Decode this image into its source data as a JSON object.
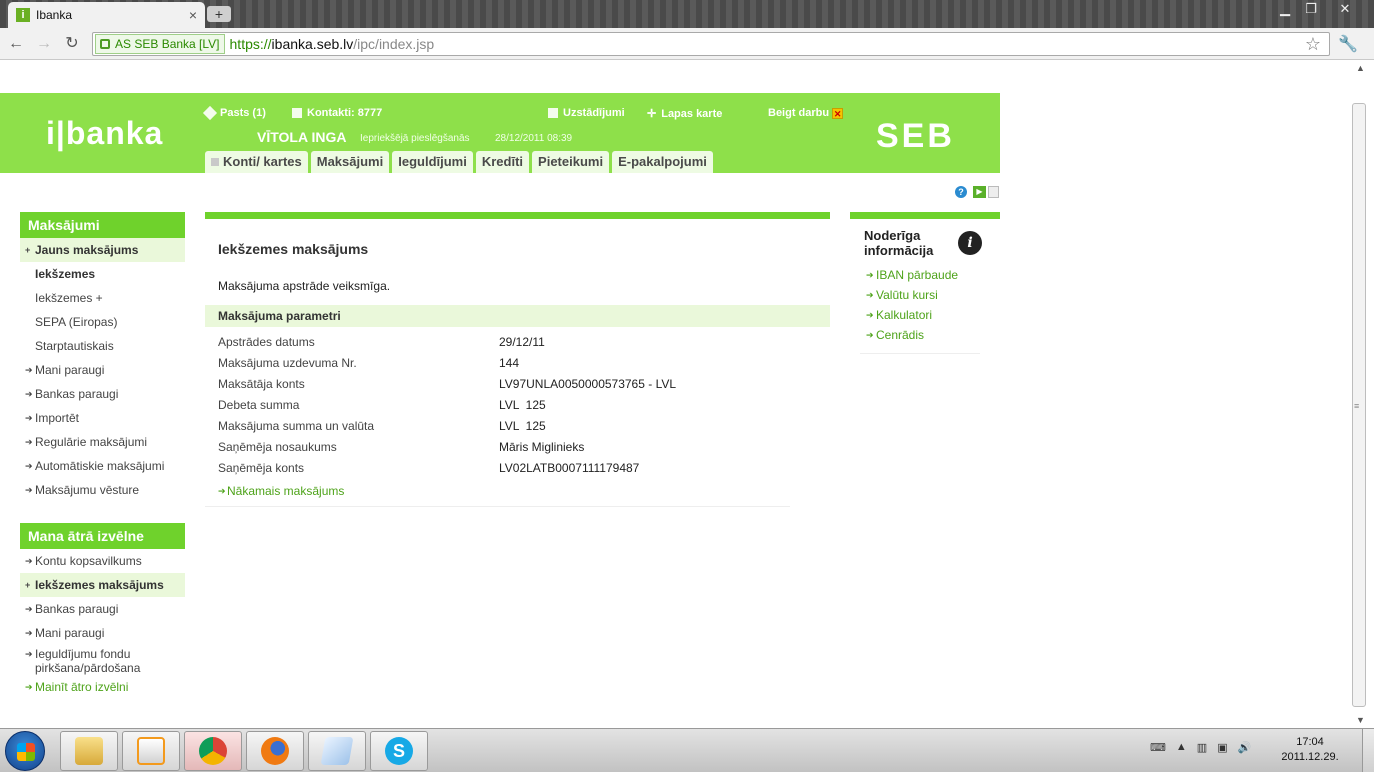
{
  "browser": {
    "tab_title": "Ibanka",
    "tab_favicon": "i",
    "tab_close": "×",
    "newtab": "+",
    "ev_label": "AS SEB Banka [LV]",
    "url_scheme": "https://",
    "url_host": "ibanka.seb.lv",
    "url_path": "/ipc/index.jsp"
  },
  "header": {
    "logo": "i|banka",
    "brand": "SEB",
    "mail": "Pasts (1)",
    "contacts": "Kontakti: 8777",
    "settings": "Uzstādījumi",
    "sitemap": "Lapas karte",
    "logout": "Beigt darbu",
    "user_name": "VĪTOLA INGA",
    "last_login_label": "Iepriekšējā pieslēgšanās",
    "last_login_date": "28/12/2011   08:39",
    "tabs": [
      "Konti/ kartes",
      "Maksājumi",
      "Ieguldījumi",
      "Kredīti",
      "Pieteikumi",
      "E-pakalpojumi"
    ]
  },
  "sidebar": {
    "title": "Maksājumi",
    "items": [
      "Jauns maksājums",
      "Iekšzemes",
      "Iekšzemes +",
      "SEPA (Eiropas)",
      "Starptautiskais",
      "Mani paraugi",
      "Bankas paraugi",
      "Importēt",
      "Regulārie maksājumi",
      "Automātiskie maksājumi",
      "Maksājumu vēsture"
    ]
  },
  "quickmenu": {
    "title": "Mana ātrā izvēlne",
    "items": [
      "Kontu kopsavilkums",
      "Iekšzemes maksājums",
      "Bankas paraugi",
      "Mani paraugi",
      "Ieguldījumu fondu pirkšana/pārdošana"
    ],
    "change_link": "Mainīt ātro izvēlni"
  },
  "main": {
    "title": "Iekšzemes maksājums",
    "message": "Maksājuma apstrāde veiksmīga.",
    "params_title": "Maksājuma parametri",
    "params": [
      {
        "label": "Apstrādes datums",
        "value": "29/12/11"
      },
      {
        "label": "Maksājuma uzdevuma Nr.",
        "value": "144"
      },
      {
        "label": "Maksātāja konts",
        "value": "LV97UNLA0050000573765 - LVL"
      },
      {
        "label": "Debeta summa",
        "value": "LVL  125"
      },
      {
        "label": "Maksājuma summa un valūta",
        "value": "LVL  125"
      },
      {
        "label": "Saņēmēja nosaukums",
        "value": "Māris Miglinieks"
      },
      {
        "label": "Saņēmēja konts",
        "value": "LV02LATB0007111179487"
      }
    ],
    "next_link": "Nākamais maksājums"
  },
  "info": {
    "title": "Noderīga informācija",
    "items": [
      "IBAN pārbaude",
      "Valūtu kursi",
      "Kalkulatori",
      "Cenrādis"
    ]
  },
  "taskbar": {
    "clock_time": "17:04",
    "clock_date": "2011.12.29."
  },
  "colors": {
    "brand_green": "#8ee04a",
    "accent_green": "#6fd22c",
    "link_green": "#4ea31a",
    "highlight": "#eaf8da"
  }
}
